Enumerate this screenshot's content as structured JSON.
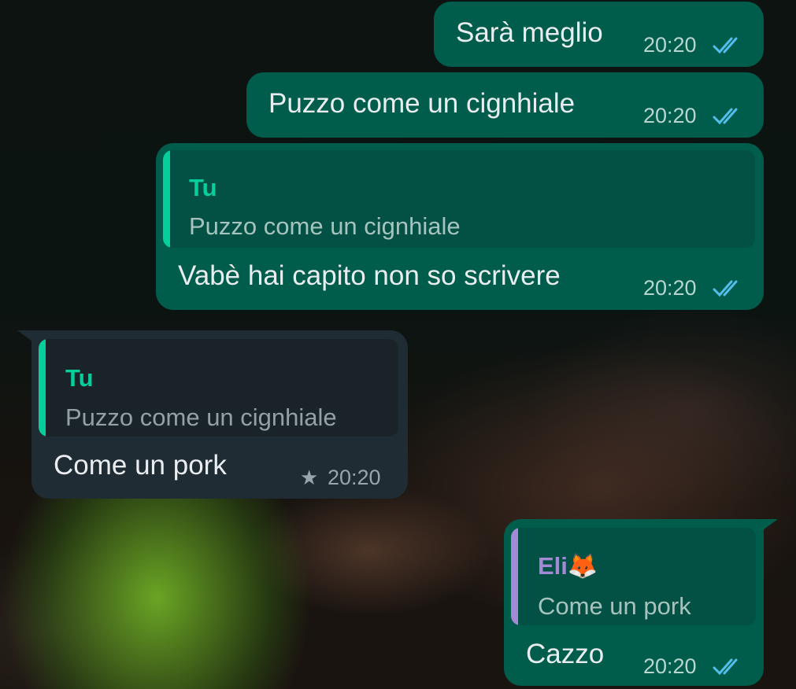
{
  "colors": {
    "outgoing_bubble": "#005c4b",
    "incoming_bubble": "#202c33",
    "read_ticks": "#53bdeb",
    "quote_self": "#06cf9c",
    "quote_contact": "#a48ad4"
  },
  "messages": [
    {
      "direction": "outgoing",
      "text": "Sarà meglio",
      "time": "20:20",
      "status_icon": "double-check-read-icon"
    },
    {
      "direction": "outgoing",
      "text": "Puzzo come un cignhiale",
      "time": "20:20",
      "status_icon": "double-check-read-icon"
    },
    {
      "direction": "outgoing",
      "quote": {
        "author": "Tu",
        "text": "Puzzo come un cignhiale"
      },
      "text": "Vabè hai capito non so scrivere",
      "time": "20:20",
      "status_icon": "double-check-read-icon"
    },
    {
      "direction": "incoming",
      "quote": {
        "author": "Tu",
        "text": "Puzzo come un cignhiale"
      },
      "text": "Come un pork",
      "time": "20:20",
      "starred": true,
      "status_icon": "star-icon"
    },
    {
      "direction": "outgoing",
      "quote": {
        "author": "Eli🦊",
        "text": "Come un pork"
      },
      "text": "Cazzo",
      "time": "20:20",
      "status_icon": "double-check-read-icon"
    }
  ]
}
